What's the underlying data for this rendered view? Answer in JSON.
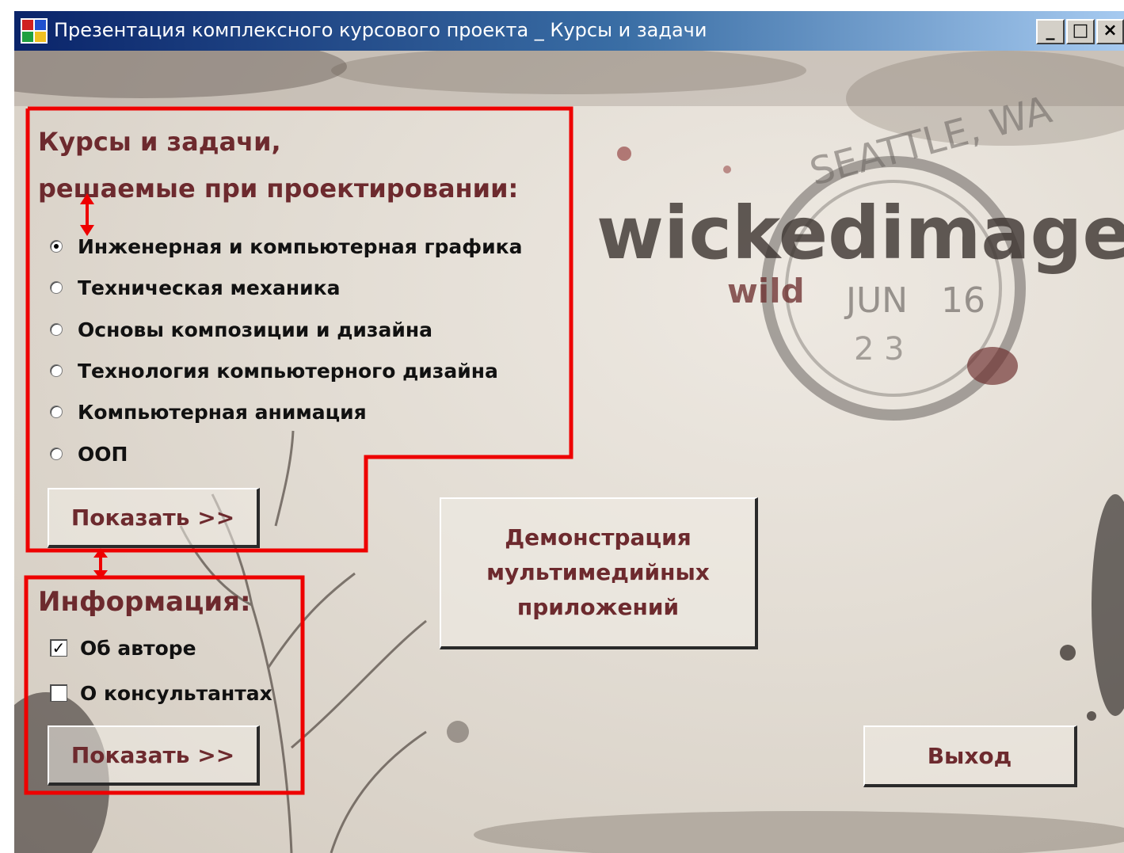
{
  "window": {
    "title": "Презентация комплексного курсового проекта _ Курсы и задачи",
    "minimize_glyph": "_",
    "maximize_glyph": "□",
    "close_glyph": "×"
  },
  "courses": {
    "heading_line1": "Курсы и задачи,",
    "heading_line2": "решаемые при проектировании:",
    "options": [
      {
        "label": "Инженерная и компьютерная графика",
        "selected": true
      },
      {
        "label": "Техническая механика",
        "selected": false
      },
      {
        "label": "Основы композиции и дизайна",
        "selected": false
      },
      {
        "label": "Технология компьютерного дизайна",
        "selected": false
      },
      {
        "label": "Компьютерная анимация",
        "selected": false
      },
      {
        "label": "ООП",
        "selected": false
      }
    ],
    "show_button": "Показать >>"
  },
  "info": {
    "heading": "Информация:",
    "items": [
      {
        "label": "Об авторе",
        "checked": true,
        "mark": "✓"
      },
      {
        "label": "О консультантах",
        "checked": false,
        "mark": ""
      }
    ],
    "show_button": "Показать >>"
  },
  "demo_button": {
    "line1": "Демонстрация",
    "line2": "мультимедийных",
    "line3": "приложений"
  },
  "exit_button": "Выход",
  "background_stamp": {
    "logo": "wickedimage",
    "sub": "wild",
    "city": "SEATTLE, WA",
    "month": "JUN",
    "day": "16",
    "year_fragment": "2   3"
  },
  "colors": {
    "accent": "#6d2a2e",
    "annotation": "#ee0000"
  }
}
